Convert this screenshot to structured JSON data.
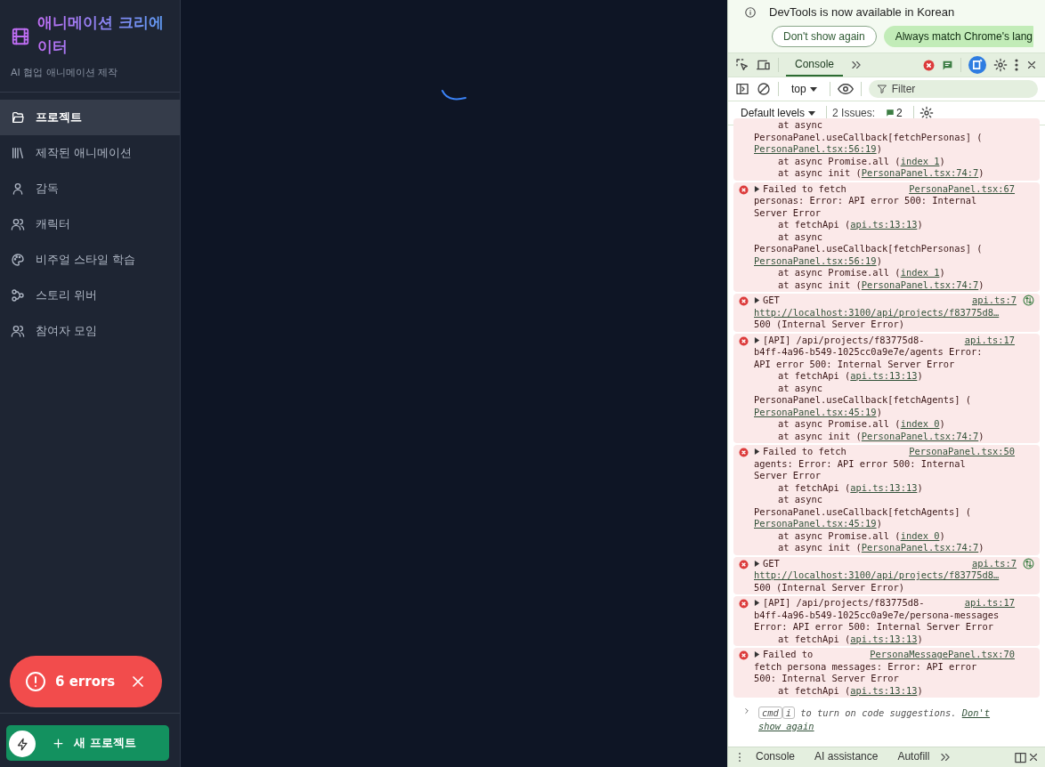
{
  "sidebar": {
    "title": "애니메이션 크리에이터",
    "subtitle": "AI 협업 애니메이션 제작",
    "items": [
      {
        "label": "프로젝트",
        "selected": true
      },
      {
        "label": "제작된 애니메이션",
        "selected": false
      },
      {
        "label": "감독",
        "selected": false
      },
      {
        "label": "캐릭터",
        "selected": false
      },
      {
        "label": "비주얼 스타일 학습",
        "selected": false
      },
      {
        "label": "스토리 위버",
        "selected": false
      },
      {
        "label": "참여자 모임",
        "selected": false
      }
    ],
    "new_button": "새 프로젝트"
  },
  "error_toast": {
    "label": "6 errors"
  },
  "devtools": {
    "infobar": {
      "message": "DevTools is now available in Korean",
      "buttons": [
        "Don't show again",
        "Always match Chrome's lang"
      ]
    },
    "tabs": [
      {
        "label": "Console",
        "selected": true
      }
    ],
    "context": "top",
    "filter": {
      "placeholder": "Filter"
    },
    "levels": "Default levels",
    "issues": {
      "label": "2 Issues:",
      "count": "2"
    },
    "messages": [
      {
        "kind": "continued",
        "lines": [
          {
            "kind": "frame",
            "parts": [
              "at async"
            ]
          },
          {
            "kind": "text",
            "parts": [
              "PersonaPanel.useCallback[fetchPersonas] ("
            ]
          },
          {
            "kind": "text",
            "parts": [
              {
                "link": "PersonaPanel.tsx:56:19"
              },
              ")"
            ]
          },
          {
            "kind": "frame",
            "parts": [
              "at async Promise.all (",
              {
                "link": "index 1"
              },
              ")"
            ]
          },
          {
            "kind": "frame",
            "parts": [
              "at async init (",
              {
                "link": "PersonaPanel.tsx:74:7"
              },
              ")"
            ]
          }
        ]
      },
      {
        "kind": "error",
        "head": "Failed to fetch",
        "source": "PersonaPanel.tsx:67",
        "lines": [
          {
            "kind": "text",
            "parts": [
              "personas: Error: API error 500: Internal"
            ]
          },
          {
            "kind": "text",
            "parts": [
              "Server Error"
            ]
          },
          {
            "kind": "frame",
            "parts": [
              "at fetchApi (",
              {
                "link": "api.ts:13:13"
              },
              ")"
            ]
          },
          {
            "kind": "frame",
            "parts": [
              "at async"
            ]
          },
          {
            "kind": "text",
            "parts": [
              "PersonaPanel.useCallback[fetchPersonas] ("
            ]
          },
          {
            "kind": "text",
            "parts": [
              {
                "link": "PersonaPanel.tsx:56:19"
              },
              ")"
            ]
          },
          {
            "kind": "frame",
            "parts": [
              "at async Promise.all (",
              {
                "link": "index 1"
              },
              ")"
            ]
          },
          {
            "kind": "frame",
            "parts": [
              "at async init (",
              {
                "link": "PersonaPanel.tsx:74:7"
              },
              ")"
            ]
          }
        ]
      },
      {
        "kind": "network",
        "head": "GET",
        "source": "api.ts:7",
        "lines": [
          {
            "kind": "text",
            "parts": [
              {
                "link": "http://localhost:3100/api/projects/f83775d8…"
              }
            ]
          },
          {
            "kind": "text",
            "parts": [
              "500 (Internal Server Error)"
            ]
          }
        ]
      },
      {
        "kind": "error",
        "head": "[API] /api/projects/f83775d8-",
        "source": "api.ts:17",
        "lines": [
          {
            "kind": "text",
            "parts": [
              "b4ff-4a96-b549-1025cc0a9e7e/agents Error:"
            ]
          },
          {
            "kind": "text",
            "parts": [
              "API error 500: Internal Server Error"
            ]
          },
          {
            "kind": "frame",
            "parts": [
              "at fetchApi (",
              {
                "link": "api.ts:13:13"
              },
              ")"
            ]
          },
          {
            "kind": "frame",
            "parts": [
              "at async"
            ]
          },
          {
            "kind": "text",
            "parts": [
              "PersonaPanel.useCallback[fetchAgents] ("
            ]
          },
          {
            "kind": "text",
            "parts": [
              {
                "link": "PersonaPanel.tsx:45:19"
              },
              ")"
            ]
          },
          {
            "kind": "frame",
            "parts": [
              "at async Promise.all (",
              {
                "link": "index 0"
              },
              ")"
            ]
          },
          {
            "kind": "frame",
            "parts": [
              "at async init (",
              {
                "link": "PersonaPanel.tsx:74:7"
              },
              ")"
            ]
          }
        ]
      },
      {
        "kind": "error",
        "head": "Failed to fetch",
        "source": "PersonaPanel.tsx:50",
        "lines": [
          {
            "kind": "text",
            "parts": [
              "agents: Error: API error 500: Internal"
            ]
          },
          {
            "kind": "text",
            "parts": [
              "Server Error"
            ]
          },
          {
            "kind": "frame",
            "parts": [
              "at fetchApi (",
              {
                "link": "api.ts:13:13"
              },
              ")"
            ]
          },
          {
            "kind": "frame",
            "parts": [
              "at async"
            ]
          },
          {
            "kind": "text",
            "parts": [
              "PersonaPanel.useCallback[fetchAgents] ("
            ]
          },
          {
            "kind": "text",
            "parts": [
              {
                "link": "PersonaPanel.tsx:45:19"
              },
              ")"
            ]
          },
          {
            "kind": "frame",
            "parts": [
              "at async Promise.all (",
              {
                "link": "index 0"
              },
              ")"
            ]
          },
          {
            "kind": "frame",
            "parts": [
              "at async init (",
              {
                "link": "PersonaPanel.tsx:74:7"
              },
              ")"
            ]
          }
        ]
      },
      {
        "kind": "network",
        "head": "GET",
        "source": "api.ts:7",
        "lines": [
          {
            "kind": "text",
            "parts": [
              {
                "link": "http://localhost:3100/api/projects/f83775d8…"
              }
            ]
          },
          {
            "kind": "text",
            "parts": [
              "500 (Internal Server Error)"
            ]
          }
        ]
      },
      {
        "kind": "error",
        "head": "[API] /api/projects/f83775d8-",
        "source": "api.ts:17",
        "lines": [
          {
            "kind": "text",
            "parts": [
              "b4ff-4a96-b549-1025cc0a9e7e/persona-messages"
            ]
          },
          {
            "kind": "text",
            "parts": [
              "Error: API error 500: Internal Server Error"
            ]
          },
          {
            "kind": "frame",
            "parts": [
              "at fetchApi (",
              {
                "link": "api.ts:13:13"
              },
              ")"
            ]
          }
        ]
      },
      {
        "kind": "error",
        "head": "Failed to",
        "source": "PersonaMessagePanel.tsx:70",
        "lines": [
          {
            "kind": "text",
            "parts": [
              "fetch persona messages: Error: API error"
            ]
          },
          {
            "kind": "text",
            "parts": [
              "500: Internal Server Error"
            ]
          },
          {
            "kind": "frame",
            "parts": [
              "at fetchApi (",
              {
                "link": "api.ts:13:13"
              },
              ")"
            ]
          }
        ]
      }
    ],
    "prompt_hint": {
      "keys": [
        "cmd",
        "i"
      ],
      "text": "to turn on code suggestions.",
      "link_lines": [
        "Don't",
        "show again"
      ]
    },
    "drawer_tabs": [
      {
        "label": "Console",
        "selected": false
      },
      {
        "label": "AI assistance",
        "selected": false
      },
      {
        "label": "Autofill",
        "selected": false
      }
    ]
  }
}
